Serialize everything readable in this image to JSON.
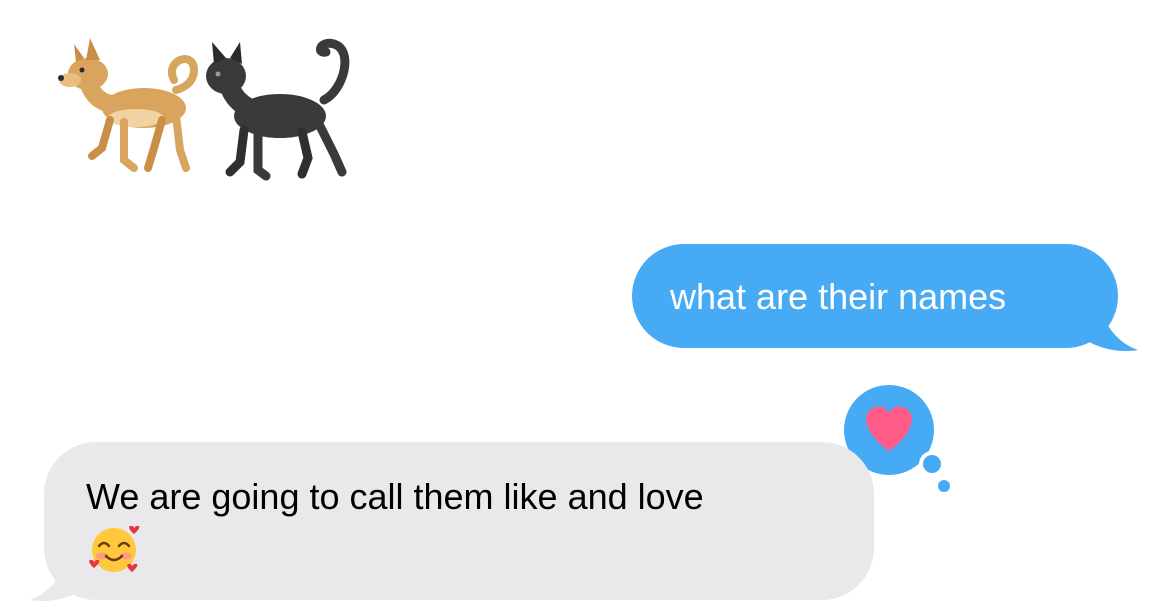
{
  "conversation": {
    "emoji_message": {
      "icons": [
        "dog-emoji",
        "black-cat-emoji"
      ]
    },
    "outgoing_message": {
      "text": "what are their names",
      "color": "#46aaf5",
      "text_color": "#ffffff"
    },
    "tapback": {
      "icon": "heart-icon",
      "bubble_color": "#46aaf5",
      "heart_color": "#ff5c8a"
    },
    "incoming_message": {
      "text": "We are going to call them like and love",
      "emoji": "smiling-face-with-hearts-emoji",
      "color": "#e9e9eb",
      "text_color": "#000000"
    }
  }
}
